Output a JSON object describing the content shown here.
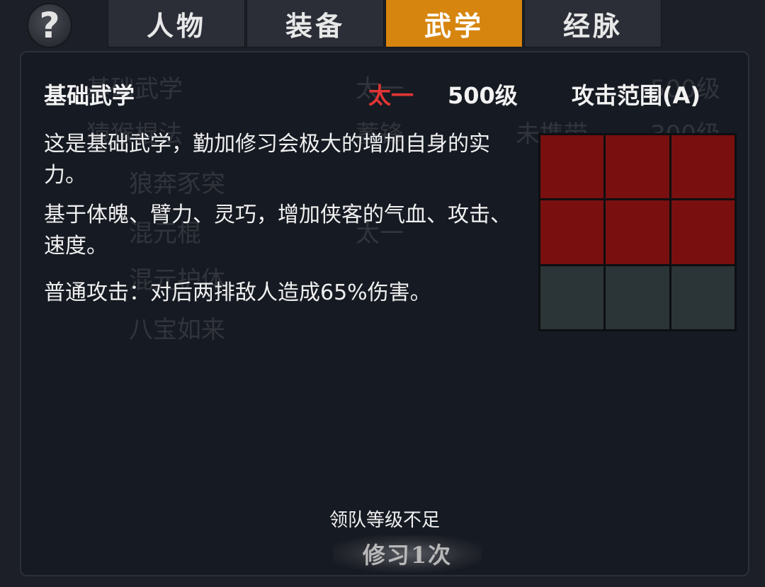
{
  "help": {
    "glyph": "?"
  },
  "tabs": [
    {
      "label": "人物",
      "active": false
    },
    {
      "label": "装备",
      "active": false
    },
    {
      "label": "武学",
      "active": true
    },
    {
      "label": "经脉",
      "active": false
    }
  ],
  "background_list": [
    {
      "name": "基础武学",
      "rank": "太一",
      "status": "",
      "level": "500级"
    },
    {
      "name": "猿猴棍法",
      "rank": "蓄锋",
      "status": "未携带",
      "level": "300级"
    },
    {
      "name": "狼奔豕突",
      "rank": "",
      "status": "",
      "level": ""
    },
    {
      "name": "混元棍",
      "rank": "太一",
      "status": "",
      "level": ""
    },
    {
      "name": "混元护体",
      "rank": "",
      "status": "",
      "level": ""
    },
    {
      "name": "八宝如来",
      "rank": "",
      "status": "",
      "level": ""
    }
  ],
  "skill": {
    "name": "基础武学",
    "rank": "太一",
    "level": "500级",
    "range_label": "攻击范围(A)",
    "description": [
      "这是基础武学，勤加修习会极大的增加自身的实力。",
      "基于体魄、臂力、灵巧，增加侠客的气血、攻击、速度。",
      "普通攻击：对后两排敌人造成65%伤害。"
    ],
    "range_grid": [
      [
        true,
        true,
        true
      ],
      [
        true,
        true,
        true
      ],
      [
        false,
        false,
        false
      ]
    ]
  },
  "footer": {
    "warning": "领队等级不足",
    "learn_button": "修习1次"
  },
  "colors": {
    "accent_tab": "#d6850f",
    "rank_red": "#e03535",
    "range_hit": "#7a0f10",
    "range_empty": "#2b3437"
  }
}
